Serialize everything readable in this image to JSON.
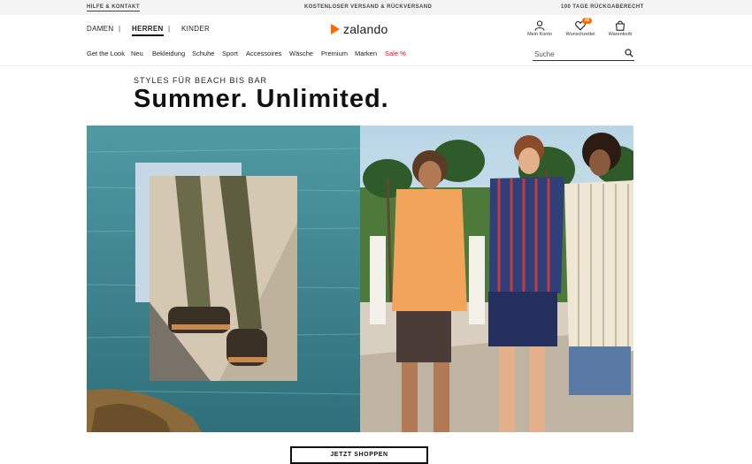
{
  "topbar": {
    "help_link": "HILFE & KONTAKT",
    "shipping": "KOSTENLOSER VERSAND & RÜCKVERSAND",
    "returns": "100 TAGE RÜCKGABERECHT"
  },
  "gender_nav": {
    "women": "DAMEN",
    "men": "HERREN",
    "kids": "KINDER",
    "separator": "|"
  },
  "logo": {
    "text": "zalando",
    "color": "#ff6900"
  },
  "user_icons": {
    "account": "Mein Konto",
    "wishlist": "Wunschzettel",
    "wishlist_count": "26",
    "cart": "Warenkorb"
  },
  "category_nav": [
    "Get the Look",
    "Neu",
    "Bekleidung",
    "Schuhe",
    "Sport",
    "Accessoires",
    "Wäsche",
    "Premium",
    "Marken",
    "Sale %"
  ],
  "search": {
    "placeholder": "Suche",
    "value": ""
  },
  "campaign": {
    "kicker": "STYLES FÜR BEACH BIS BAR",
    "headline": "Summer. Unlimited.",
    "cta": "JETZT SHOPPEN"
  },
  "colors": {
    "accent": "#ff6900",
    "sale": "#e4002b",
    "sea": "#3f8a96",
    "tee": "#f2a55a"
  }
}
